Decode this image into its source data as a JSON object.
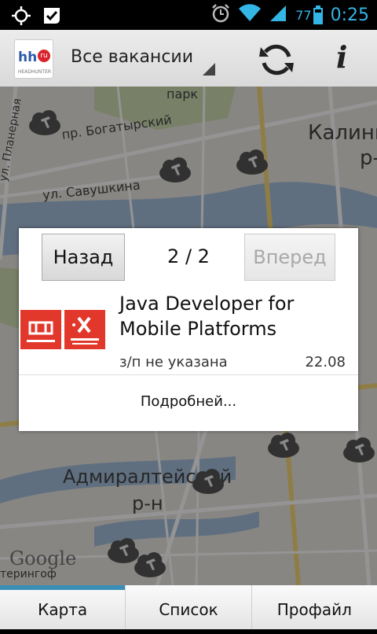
{
  "status_bar": {
    "time": "0:25",
    "battery": "77"
  },
  "action_bar": {
    "logo_text": "hh",
    "logo_badge": "ru",
    "logo_subtext": "HEADHUNTER",
    "spinner_label": "Все вакансии"
  },
  "map": {
    "labels": {
      "park": "парк",
      "bogatyrsky": "пр. Богатырский",
      "savushkina": "ул. Савушкина",
      "planernaya": "ул. Планерная",
      "kalini": "Калини",
      "rn_right": "р-н",
      "admiral": "Адмиралтейский",
      "rn_bottom": "р-н",
      "google": "Google",
      "teringof": "терингоф"
    }
  },
  "dialog": {
    "back_label": "Назад",
    "forward_label": "Вперед",
    "pager": "2 / 2",
    "job_title": "Java Developer for Mobile Platforms",
    "salary": "з/п не указана",
    "date": "22.08",
    "more_label": "Подробней...",
    "company_logo_colors": {
      "red": "#e2372b"
    }
  },
  "tabs": [
    {
      "label": "Карта",
      "active": true
    },
    {
      "label": "Список",
      "active": false
    },
    {
      "label": "Профайл",
      "active": false
    }
  ],
  "colors": {
    "accent": "#33b5e5",
    "tab_indicator": "#3a8fb7"
  }
}
